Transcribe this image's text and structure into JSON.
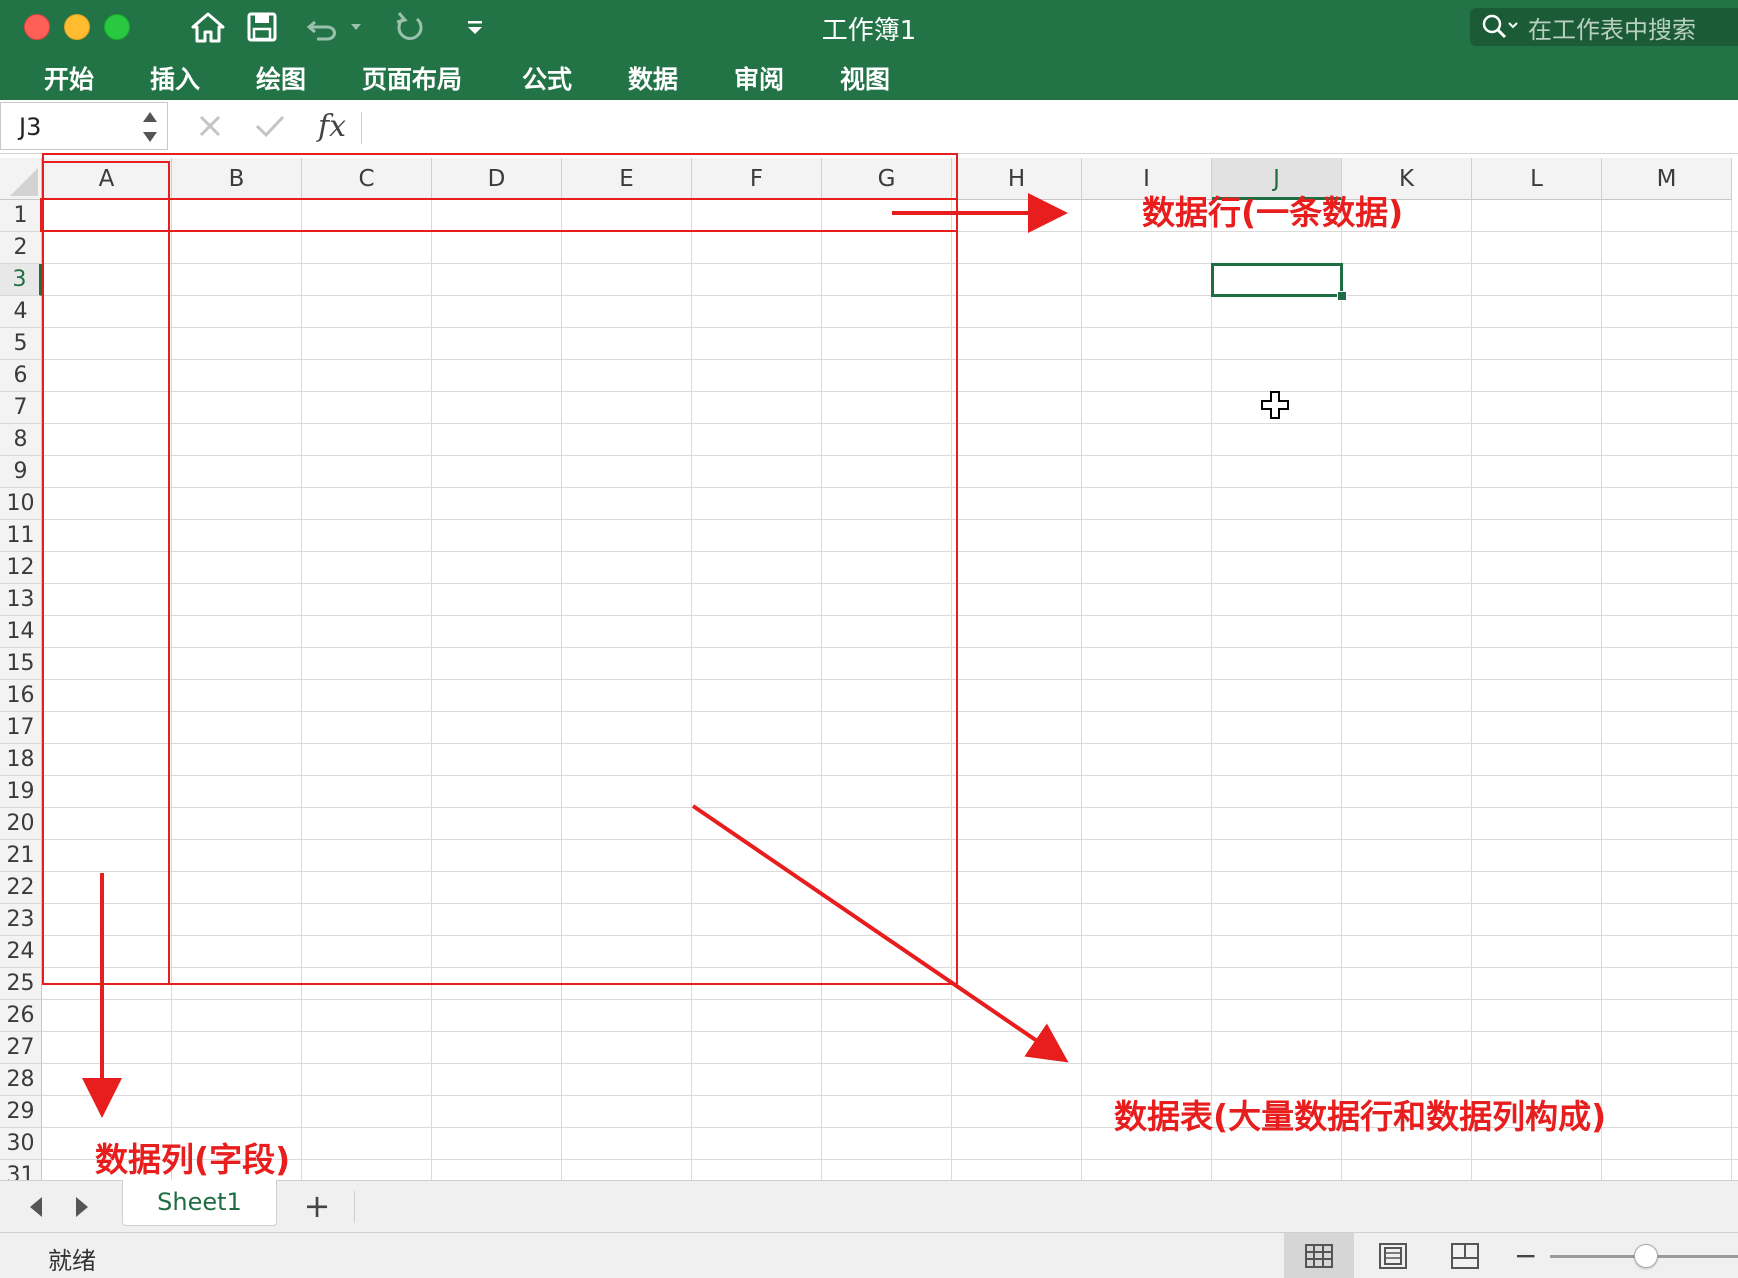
{
  "window": {
    "title": "工作簿1",
    "search_placeholder": "在工作表中搜索"
  },
  "ribbon": {
    "tabs": [
      "开始",
      "插入",
      "绘图",
      "页面布局",
      "公式",
      "数据",
      "审阅",
      "视图"
    ]
  },
  "formula_bar": {
    "name_box": "J3",
    "formula": ""
  },
  "grid": {
    "columns": [
      "A",
      "B",
      "C",
      "D",
      "E",
      "F",
      "G",
      "H",
      "I",
      "J",
      "K",
      "L",
      "M"
    ],
    "rows": [
      "1",
      "2",
      "3",
      "4",
      "5",
      "6",
      "7",
      "8",
      "9",
      "10",
      "11",
      "12",
      "13",
      "14",
      "15",
      "16",
      "17",
      "18",
      "19",
      "20",
      "21",
      "22",
      "23",
      "24",
      "25",
      "26",
      "27",
      "28",
      "29",
      "30",
      "31"
    ],
    "active_column": "J",
    "active_row": "3"
  },
  "annotations": {
    "row_label": "数据行(一条数据)",
    "column_label": "数据列(字段)",
    "table_label": "数据表(大量数据行和数据列构成)",
    "color": "#e81d1d"
  },
  "sheets": {
    "tabs": [
      "Sheet1"
    ],
    "add_symbol": "+"
  },
  "status": {
    "text": "就绪"
  },
  "theme": {
    "accent": "#227447",
    "selection": "#1f6e43"
  }
}
